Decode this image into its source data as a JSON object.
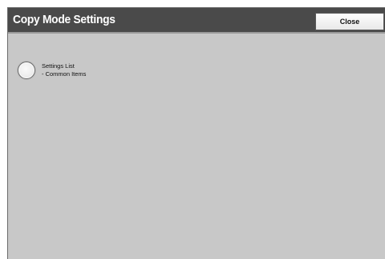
{
  "header": {
    "title": "Copy Mode Settings",
    "close_label": "Close"
  },
  "options": [
    {
      "label_line1": "Settings List",
      "label_line2": "- Common Items",
      "selected": false
    }
  ],
  "colors": {
    "title_bar": "#4a4a4a",
    "background": "#c8c8c8"
  }
}
